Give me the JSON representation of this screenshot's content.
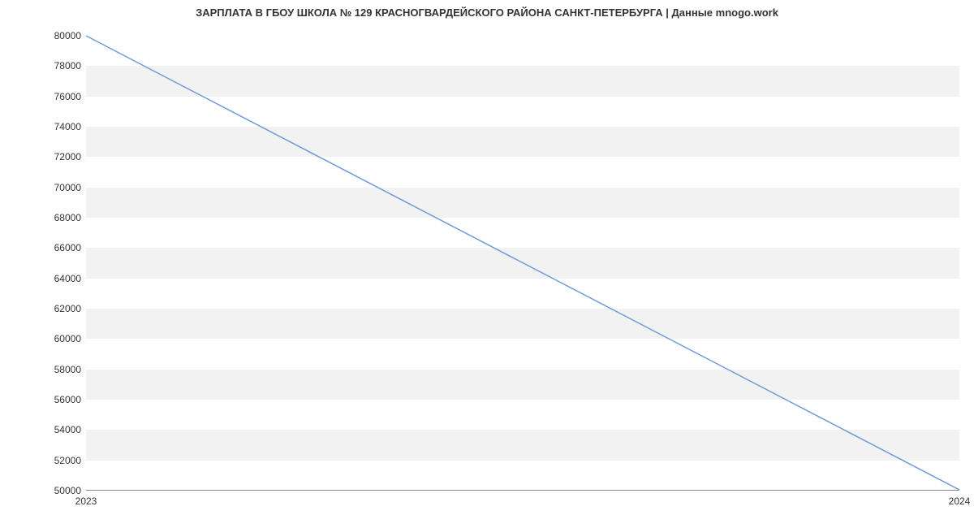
{
  "chart_data": {
    "type": "line",
    "title": "ЗАРПЛАТА В ГБОУ ШКОЛА № 129 КРАСНОГВАРДЕЙСКОГО РАЙОНА САНКТ-ПЕТЕРБУРГА | Данные mnogo.work",
    "xlabel": "",
    "ylabel": "",
    "x": [
      2023,
      2024
    ],
    "x_ticks": [
      2023,
      2024
    ],
    "y_ticks": [
      50000,
      52000,
      54000,
      56000,
      58000,
      60000,
      62000,
      64000,
      66000,
      68000,
      70000,
      72000,
      74000,
      76000,
      78000,
      80000
    ],
    "ylim": [
      50000,
      80000
    ],
    "series": [
      {
        "name": "salary",
        "values": [
          80000,
          50000
        ]
      }
    ],
    "line_color": "#6f9bd8",
    "band_color": "#f2f2f2"
  }
}
